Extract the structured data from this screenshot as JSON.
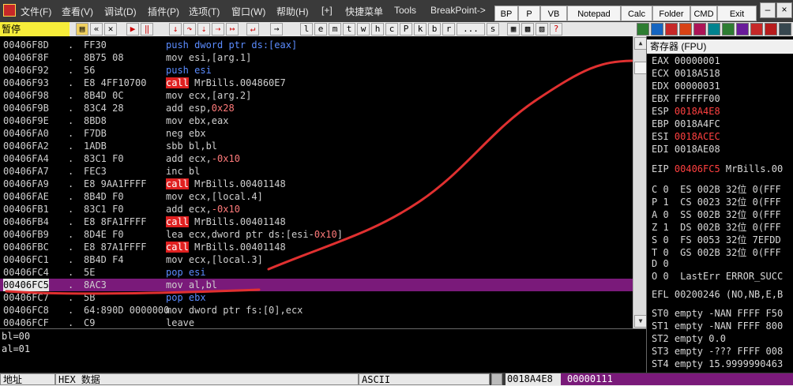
{
  "menu": {
    "items": [
      "文件(F)",
      "查看(V)",
      "调试(D)",
      "插件(P)",
      "选项(T)",
      "窗口(W)",
      "帮助(H)",
      "[+]",
      "快捷菜单",
      "Tools",
      "BreakPoint->"
    ]
  },
  "plugin_buttons": [
    "BP",
    "P",
    "VB",
    "Notepad",
    "Calc",
    "Folder",
    "CMD",
    "Exit"
  ],
  "toolbar": {
    "status": "暂停",
    "letters": [
      "l",
      "e",
      "m",
      "t",
      "w",
      "h",
      "c",
      "P",
      "k",
      "b",
      "r",
      "...",
      "s"
    ]
  },
  "disasm": {
    "rows": [
      {
        "addr": "00406F8D",
        "mark": ".",
        "hex": "FF30",
        "asm": [
          {
            "t": "push dword ptr ds:[eax]",
            "c": "kw-push"
          }
        ]
      },
      {
        "addr": "00406F8F",
        "mark": ".",
        "hex": "8B75 08",
        "asm": [
          {
            "t": "mov esi,[arg.1]",
            "c": ""
          }
        ]
      },
      {
        "addr": "00406F92",
        "mark": ".",
        "hex": "56",
        "asm": [
          {
            "t": "push esi",
            "c": "kw-push"
          }
        ]
      },
      {
        "addr": "00406F93",
        "mark": ".",
        "hex": "E8 4FF10700",
        "asm": [
          {
            "t": "call",
            "c": "kw-call"
          },
          {
            "t": " MrBills.004860E7",
            "c": ""
          }
        ]
      },
      {
        "addr": "00406F98",
        "mark": ".",
        "hex": "8B4D 0C",
        "asm": [
          {
            "t": "mov ecx,[arg.2]",
            "c": ""
          }
        ]
      },
      {
        "addr": "00406F9B",
        "mark": ".",
        "hex": "83C4 28",
        "asm": [
          {
            "t": "add esp,",
            "c": ""
          },
          {
            "t": "0x28",
            "c": "num"
          }
        ]
      },
      {
        "addr": "00406F9E",
        "mark": ".",
        "hex": "8BD8",
        "asm": [
          {
            "t": "mov ebx,eax",
            "c": ""
          }
        ]
      },
      {
        "addr": "00406FA0",
        "mark": ".",
        "hex": "F7DB",
        "asm": [
          {
            "t": "neg ebx",
            "c": ""
          }
        ]
      },
      {
        "addr": "00406FA2",
        "mark": ".",
        "hex": "1ADB",
        "asm": [
          {
            "t": "sbb bl,bl",
            "c": ""
          }
        ]
      },
      {
        "addr": "00406FA4",
        "mark": ".",
        "hex": "83C1 F0",
        "asm": [
          {
            "t": "add ecx,",
            "c": ""
          },
          {
            "t": "-0x10",
            "c": "num"
          }
        ]
      },
      {
        "addr": "00406FA7",
        "mark": ".",
        "hex": "FEC3",
        "asm": [
          {
            "t": "inc bl",
            "c": ""
          }
        ]
      },
      {
        "addr": "00406FA9",
        "mark": ".",
        "hex": "E8 9AA1FFFF",
        "asm": [
          {
            "t": "call",
            "c": "kw-call"
          },
          {
            "t": " MrBills.00401148",
            "c": ""
          }
        ]
      },
      {
        "addr": "00406FAE",
        "mark": ".",
        "hex": "8B4D F0",
        "asm": [
          {
            "t": "mov ecx,[local.4]",
            "c": ""
          }
        ]
      },
      {
        "addr": "00406FB1",
        "mark": ".",
        "hex": "83C1 F0",
        "asm": [
          {
            "t": "add ecx,",
            "c": ""
          },
          {
            "t": "-0x10",
            "c": "num"
          }
        ]
      },
      {
        "addr": "00406FB4",
        "mark": ".",
        "hex": "E8 8FA1FFFF",
        "asm": [
          {
            "t": "call",
            "c": "kw-call"
          },
          {
            "t": " MrBills.00401148",
            "c": ""
          }
        ]
      },
      {
        "addr": "00406FB9",
        "mark": ".",
        "hex": "8D4E F0",
        "asm": [
          {
            "t": "lea ecx,dword ptr ds:[esi-",
            "c": ""
          },
          {
            "t": "0x10",
            "c": "num"
          },
          {
            "t": "]",
            "c": ""
          }
        ]
      },
      {
        "addr": "00406FBC",
        "mark": ".",
        "hex": "E8 87A1FFFF",
        "asm": [
          {
            "t": "call",
            "c": "kw-call"
          },
          {
            "t": " MrBills.00401148",
            "c": ""
          }
        ]
      },
      {
        "addr": "00406FC1",
        "mark": ".",
        "hex": "8B4D F4",
        "asm": [
          {
            "t": "mov ecx,[local.3]",
            "c": ""
          }
        ]
      },
      {
        "addr": "00406FC4",
        "mark": ".",
        "hex": "5E",
        "asm": [
          {
            "t": "pop esi",
            "c": "kw-push"
          }
        ]
      },
      {
        "addr": "00406FC5",
        "mark": ".",
        "hex": "8AC3",
        "asm": [
          {
            "t": "mov al,bl",
            "c": ""
          }
        ],
        "selected": true
      },
      {
        "addr": "00406FC7",
        "mark": ".",
        "hex": "5B",
        "asm": [
          {
            "t": "pop ebx",
            "c": "kw-push"
          }
        ]
      },
      {
        "addr": "00406FC8",
        "mark": ".",
        "hex": "64:890D 0000000",
        "asm": [
          {
            "t": "mov dword ptr fs:[0],ecx",
            "c": ""
          }
        ]
      },
      {
        "addr": "00406FCF",
        "mark": ".",
        "hex": "C9",
        "asm": [
          {
            "t": "leave",
            "c": ""
          }
        ]
      }
    ]
  },
  "info": {
    "lines": [
      "bl=00",
      "al=01"
    ]
  },
  "registers": {
    "title": "寄存器 (FPU)",
    "gp": [
      {
        "n": "EAX",
        "v": "00000001",
        "red": false
      },
      {
        "n": "ECX",
        "v": "0018A518",
        "red": false
      },
      {
        "n": "EDX",
        "v": "00000031",
        "red": false
      },
      {
        "n": "EBX",
        "v": "FFFFFF00",
        "red": false
      },
      {
        "n": "ESP",
        "v": "0018A4E8",
        "red": true
      },
      {
        "n": "EBP",
        "v": "0018A4FC",
        "red": false
      },
      {
        "n": "ESI",
        "v": "0018ACEC",
        "red": true
      },
      {
        "n": "EDI",
        "v": "0018AE08",
        "red": false
      }
    ],
    "eip": {
      "n": "EIP",
      "v": "00406FC5",
      "rest": "MrBills.00"
    },
    "flags": [
      "C 0  ES 002B 32位 0(FFF",
      "P 1  CS 0023 32位 0(FFF",
      "A 0  SS 002B 32位 0(FFF",
      "Z 1  DS 002B 32位 0(FFF",
      "S 0  FS 0053 32位 7EFDD",
      "T 0  GS 002B 32位 0(FFF",
      "D 0",
      "O 0  LastErr ERROR_SUCC"
    ],
    "efl": "EFL 00200246 (NO,NB,E,B",
    "fpu": [
      "ST0 empty -NAN FFFF F50",
      "ST1 empty -NAN FFFF 800",
      "ST2 empty 0.0",
      "ST3 empty -??? FFFF 008",
      "ST4 empty 15.9999990463"
    ]
  },
  "bottom": {
    "addr_col": "地址",
    "hex_col": "HEX 数据",
    "ascii_col": "ASCII",
    "stack_addr": "0018A4E8",
    "stack_val": "00000111"
  },
  "colors": {
    "selection": "#7a1a7a",
    "call": "#e02020",
    "push": "#5b8cff",
    "annotation_stroke": "#e03030"
  }
}
